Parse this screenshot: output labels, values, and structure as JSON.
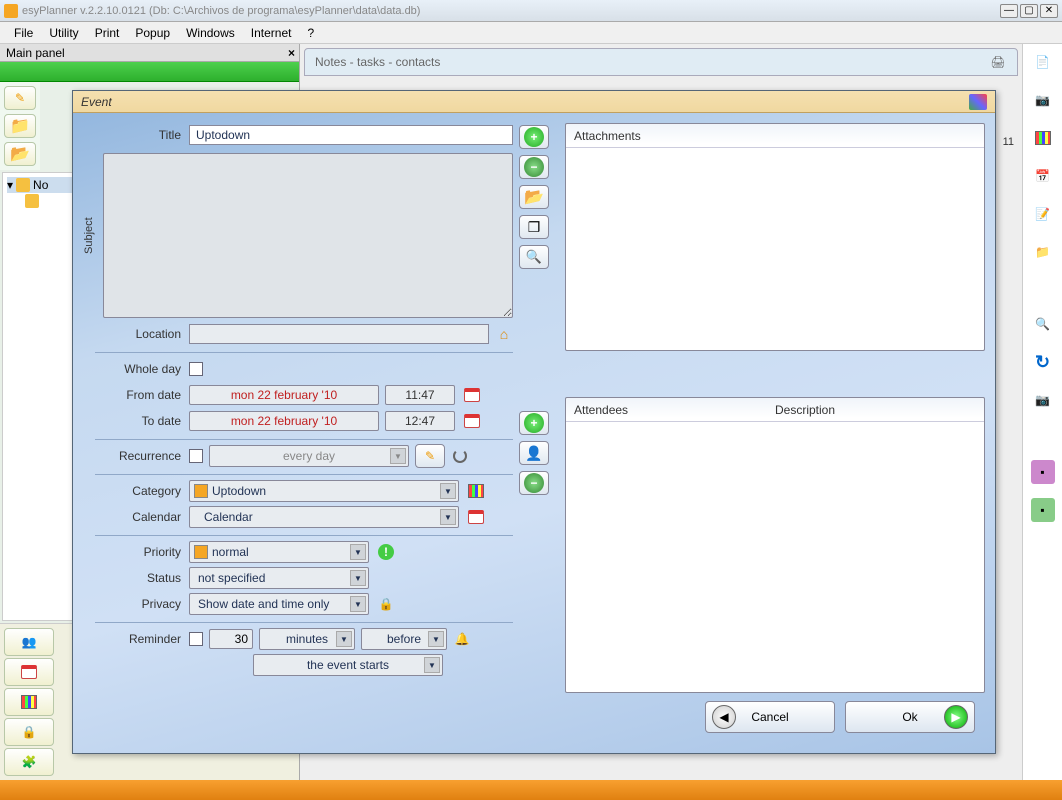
{
  "window": {
    "title": "esyPlanner v.2.2.10.0121 (Db: C:\\Archivos de programa\\esyPlanner\\data\\data.db)"
  },
  "menubar": [
    "File",
    "Utility",
    "Print",
    "Popup",
    "Windows",
    "Internet",
    "?"
  ],
  "main_panel_title": "Main panel",
  "tree": {
    "root": "No",
    "child_prefix": ""
  },
  "main_header": "Notes - tasks - contacts",
  "right_badge": "11",
  "event": {
    "dialog_title": "Event",
    "labels": {
      "title": "Title",
      "subject": "Subject",
      "location": "Location",
      "whole_day": "Whole day",
      "from_date": "From date",
      "to_date": "To date",
      "recurrence": "Recurrence",
      "category": "Category",
      "calendar": "Calendar",
      "priority": "Priority",
      "status": "Status",
      "privacy": "Privacy",
      "reminder": "Reminder",
      "attachments": "Attachments",
      "attendees": "Attendees",
      "description": "Description"
    },
    "values": {
      "title": "Uptodown",
      "location": "",
      "whole_day": false,
      "from_date": "mon 22 february '10",
      "from_time": "11:47",
      "to_date": "mon 22 february '10",
      "to_time": "12:47",
      "recurrence_enabled": false,
      "recurrence_pattern": "every day",
      "category": "Uptodown",
      "calendar": "Calendar",
      "priority": "normal",
      "status": "not specified",
      "privacy": "Show date and time only",
      "reminder_enabled": false,
      "reminder_value": "30",
      "reminder_unit": "minutes",
      "reminder_relation": "before",
      "reminder_anchor": "the event starts"
    },
    "buttons": {
      "cancel": "Cancel",
      "ok": "Ok"
    }
  }
}
